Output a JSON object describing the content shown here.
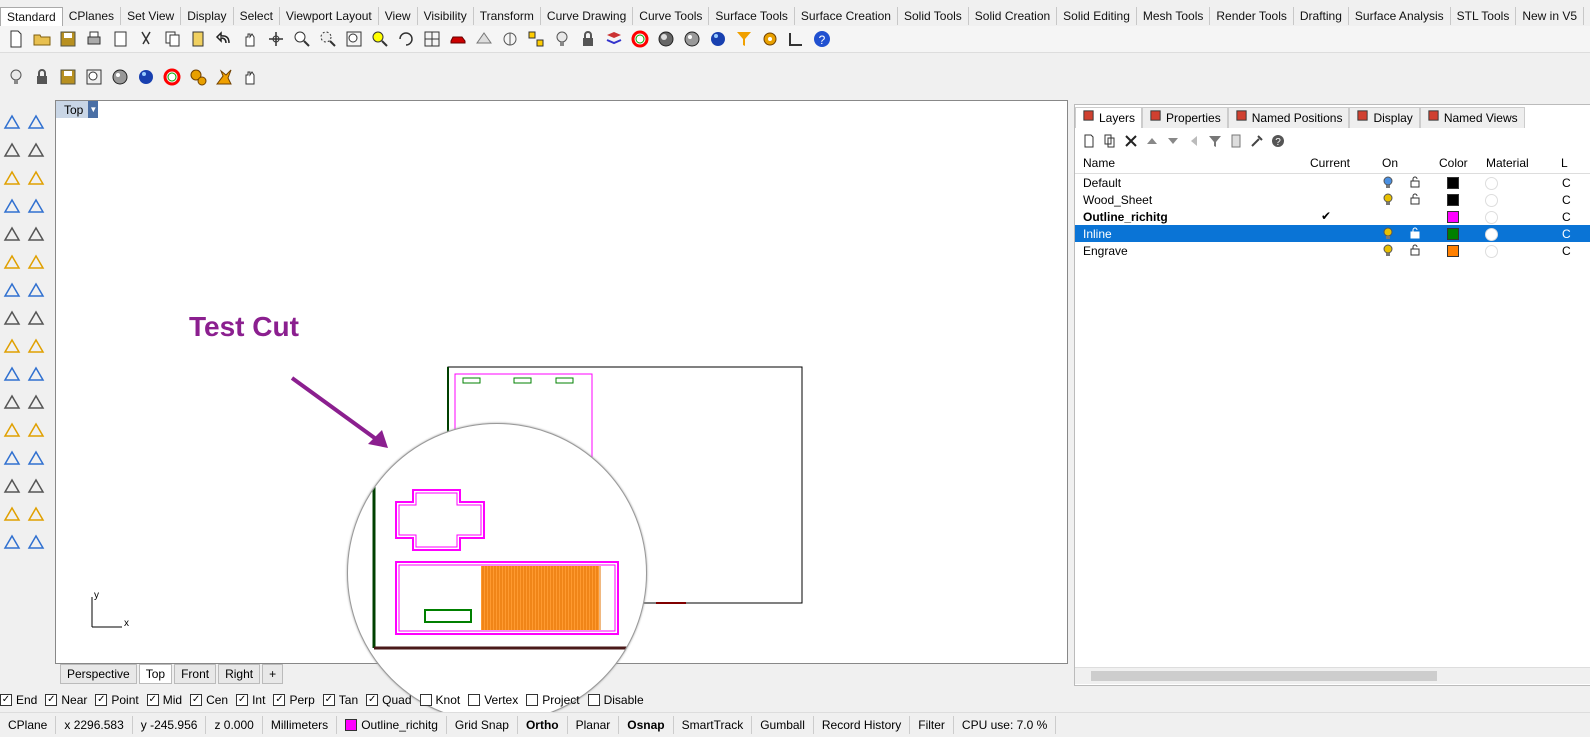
{
  "menu_tabs": [
    "Standard",
    "CPlanes",
    "Set View",
    "Display",
    "Select",
    "Viewport Layout",
    "View",
    "Visibility",
    "Transform",
    "Curve Drawing",
    "Curve Tools",
    "Surface Tools",
    "Surface Creation",
    "Solid Tools",
    "Solid Creation",
    "Solid Editing",
    "Mesh Tools",
    "Render Tools",
    "Drafting",
    "Surface Analysis",
    "STL Tools",
    "New in V5"
  ],
  "toolbar1_icons": [
    "new-file-icon",
    "open-folder-icon",
    "save-icon",
    "print-icon",
    "import-icon",
    "cut-icon",
    "copy-icon",
    "paste-icon",
    "undo-icon",
    "pan-hand-icon",
    "rotate-view-icon",
    "zoom-icon",
    "zoom-window-icon",
    "zoom-extents-icon",
    "zoom-selected-icon",
    "rotate-icon",
    "grid-icon",
    "car-icon",
    "render-icon",
    "circle-target-icon",
    "snap-icon",
    "light-bulb-icon",
    "lock-icon",
    "layer-icon",
    "color-wheel-icon",
    "sphere-shade-icon",
    "sphere-grey-icon",
    "sphere-blue-icon",
    "filter-icon",
    "gear-icon",
    "ortho-icon",
    "help-icon"
  ],
  "toolbar2_icons": [
    "light-bulb-icon",
    "lock-icon",
    "save-icon",
    "zoom-extents-icon",
    "sphere-grey-icon",
    "sphere-blue-icon",
    "color-wheel-icon",
    "gears-icon",
    "explode-icon",
    "pan-hand-icon"
  ],
  "viewport": {
    "title": "Top",
    "annotation_text": "Test Cut",
    "axis_x": "x",
    "axis_y": "y"
  },
  "viewport_tabs": [
    "Perspective",
    "Top",
    "Front",
    "Right"
  ],
  "viewport_active_tab": "Top",
  "panel": {
    "tabs": [
      {
        "label": "Layers",
        "icon": "layers-icon"
      },
      {
        "label": "Properties",
        "icon": "properties-icon"
      },
      {
        "label": "Named Positions",
        "icon": "named-positions-icon"
      },
      {
        "label": "Display",
        "icon": "display-icon"
      },
      {
        "label": "Named Views",
        "icon": "camera-icon"
      }
    ],
    "columns": {
      "name": "Name",
      "current": "Current",
      "on": "On",
      "color": "Color",
      "material": "Material",
      "extra": "L"
    },
    "layers": [
      {
        "name": "Default",
        "current": "",
        "color": "#000000",
        "bulb": "#4a90e2",
        "bold": false,
        "selected": false
      },
      {
        "name": "Wood_Sheet",
        "current": "",
        "color": "#000000",
        "bulb": "#e8c000",
        "bold": false,
        "selected": false
      },
      {
        "name": "Outline_richitg",
        "current": "✔",
        "color": "#ff00ff",
        "bulb": "",
        "bold": true,
        "selected": false
      },
      {
        "name": "Inline",
        "current": "",
        "color": "#008000",
        "bulb": "#e8c000",
        "bold": false,
        "selected": true
      },
      {
        "name": "Engrave",
        "current": "",
        "color": "#ff8000",
        "bulb": "#e8c000",
        "bold": false,
        "selected": false
      }
    ],
    "clip_text": "C"
  },
  "osnap": [
    {
      "label": "End",
      "checked": true
    },
    {
      "label": "Near",
      "checked": true
    },
    {
      "label": "Point",
      "checked": true
    },
    {
      "label": "Mid",
      "checked": true
    },
    {
      "label": "Cen",
      "checked": true
    },
    {
      "label": "Int",
      "checked": true
    },
    {
      "label": "Perp",
      "checked": true
    },
    {
      "label": "Tan",
      "checked": true
    },
    {
      "label": "Quad",
      "checked": true
    },
    {
      "label": "Knot",
      "checked": false
    },
    {
      "label": "Vertex",
      "checked": false
    },
    {
      "label": "Project",
      "checked": false
    },
    {
      "label": "Disable",
      "checked": false
    }
  ],
  "status": {
    "cplane": "CPlane",
    "x": "x 2296.583",
    "y": "y -245.956",
    "z": "z 0.000",
    "units": "Millimeters",
    "layer": "Outline_richitg",
    "layer_color": "#ff00ff",
    "grid_snap": "Grid Snap",
    "ortho": "Ortho",
    "planar": "Planar",
    "osnap": "Osnap",
    "smarttrack": "SmartTrack",
    "gumball": "Gumball",
    "record_history": "Record History",
    "filter": "Filter",
    "cpu": "CPU use: 7.0 %"
  }
}
